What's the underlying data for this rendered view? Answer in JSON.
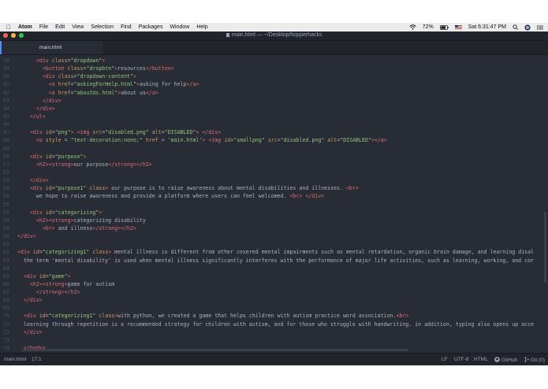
{
  "menubar": {
    "app_name": "Atom",
    "items": [
      "File",
      "Edit",
      "View",
      "Selection",
      "Find",
      "Packages",
      "Window",
      "Help"
    ],
    "battery": "72%",
    "clock": "Sat 6:31:47 PM"
  },
  "window": {
    "title": "main.html — ~/Desktop/hopperhacks"
  },
  "tabs": [
    {
      "label": "main.html"
    }
  ],
  "editor": {
    "lines": [
      {
        "n": "38",
        "indent": 6,
        "t": [
          [
            "tg",
            "<div "
          ],
          [
            "at",
            "class"
          ],
          [
            "tx",
            "="
          ],
          [
            "st",
            "\"dropdown\""
          ],
          [
            "tg",
            ">"
          ]
        ]
      },
      {
        "n": "39",
        "indent": 8,
        "t": [
          [
            "tg",
            "<button "
          ],
          [
            "at",
            "class"
          ],
          [
            "tx",
            "="
          ],
          [
            "st",
            "\"dropbtn\""
          ],
          [
            "tg",
            ">"
          ],
          [
            "tx",
            "resources"
          ],
          [
            "tg",
            "</button>"
          ]
        ]
      },
      {
        "n": "40",
        "indent": 8,
        "t": [
          [
            "tg",
            "<div "
          ],
          [
            "at",
            "class"
          ],
          [
            "tx",
            "="
          ],
          [
            "st",
            "\"dropdown-content\""
          ],
          [
            "tg",
            ">"
          ]
        ]
      },
      {
        "n": "41",
        "indent": 10,
        "t": [
          [
            "tg",
            "<a "
          ],
          [
            "at",
            "href"
          ],
          [
            "tx",
            "="
          ],
          [
            "st",
            "\"askingForHelp.html\""
          ],
          [
            "tg",
            ">"
          ],
          [
            "tx",
            "asking for help"
          ],
          [
            "tg",
            "</a>"
          ]
        ]
      },
      {
        "n": "42",
        "indent": 10,
        "t": [
          [
            "tg",
            "<a "
          ],
          [
            "at",
            "href"
          ],
          [
            "tx",
            "="
          ],
          [
            "st",
            "\"aboutUs.html\""
          ],
          [
            "tg",
            ">"
          ],
          [
            "tx",
            "about us"
          ],
          [
            "tg",
            "</a>"
          ]
        ]
      },
      {
        "n": "43",
        "indent": 8,
        "t": [
          [
            "tg",
            "</div>"
          ]
        ]
      },
      {
        "n": "44",
        "indent": 6,
        "t": [
          [
            "tg",
            "</div>"
          ]
        ]
      },
      {
        "n": "45",
        "indent": 4,
        "t": [
          [
            "tg",
            "</ul>"
          ]
        ]
      },
      {
        "n": "46",
        "indent": 0,
        "t": []
      },
      {
        "n": "47",
        "indent": 4,
        "t": [
          [
            "tg",
            "<div "
          ],
          [
            "at",
            "id"
          ],
          [
            "tx",
            "="
          ],
          [
            "st",
            "\"png\""
          ],
          [
            "tg",
            ">"
          ],
          [
            "tx",
            " "
          ],
          [
            "tg",
            "<img "
          ],
          [
            "at",
            "src"
          ],
          [
            "tx",
            "="
          ],
          [
            "st",
            "\"disabled.png\""
          ],
          [
            "tx",
            " "
          ],
          [
            "at",
            "alt"
          ],
          [
            "tx",
            "="
          ],
          [
            "st",
            "\"DISABLED\""
          ],
          [
            "tg",
            ">"
          ],
          [
            "tx",
            " "
          ],
          [
            "tg",
            "</div>"
          ]
        ]
      },
      {
        "n": "48",
        "indent": 6,
        "t": [
          [
            "tg",
            "<a "
          ],
          [
            "at",
            "style"
          ],
          [
            "tx",
            " = "
          ],
          [
            "st",
            "\"text-decoration:none;\""
          ],
          [
            "tx",
            " "
          ],
          [
            "at",
            "href"
          ],
          [
            "tx",
            " = "
          ],
          [
            "st",
            "'main.html'"
          ],
          [
            "tg",
            ">"
          ],
          [
            "tx",
            " "
          ],
          [
            "tg",
            "<img "
          ],
          [
            "at",
            "id"
          ],
          [
            "tx",
            "="
          ],
          [
            "st",
            "\"smallpng\""
          ],
          [
            "tx",
            " "
          ],
          [
            "at",
            "src"
          ],
          [
            "tx",
            "="
          ],
          [
            "st",
            "\"disabled.png\""
          ],
          [
            "tx",
            " "
          ],
          [
            "at",
            "alt"
          ],
          [
            "tx",
            "="
          ],
          [
            "st",
            "\"DISABLED\""
          ],
          [
            "tg",
            "></a>"
          ]
        ]
      },
      {
        "n": "49",
        "indent": 0,
        "t": []
      },
      {
        "n": "50",
        "indent": 4,
        "t": [
          [
            "tg",
            "<div "
          ],
          [
            "at",
            "id"
          ],
          [
            "tx",
            "="
          ],
          [
            "st",
            "\"purpose\""
          ],
          [
            "tg",
            ">"
          ]
        ]
      },
      {
        "n": "51",
        "indent": 6,
        "t": [
          [
            "tg",
            "<h2><strong>"
          ],
          [
            "tx",
            "our purpose"
          ],
          [
            "tg",
            "</strong></h2>"
          ]
        ]
      },
      {
        "n": "52",
        "indent": 0,
        "t": []
      },
      {
        "n": "53",
        "indent": 4,
        "t": [
          [
            "tg",
            "</div>"
          ]
        ]
      },
      {
        "n": "54",
        "indent": 4,
        "t": [
          [
            "tg",
            "<div "
          ],
          [
            "at",
            "id"
          ],
          [
            "tx",
            "="
          ],
          [
            "st",
            "\"purpose1\""
          ],
          [
            "tx",
            " "
          ],
          [
            "at",
            "class"
          ],
          [
            "tg",
            ">"
          ],
          [
            "tx",
            " our purpose is to raise awareness about mental disabilities and illnesses. "
          ],
          [
            "tg",
            "<br>"
          ]
        ]
      },
      {
        "n": "55",
        "indent": 6,
        "t": [
          [
            "tx",
            "we hope to raise awareness and provide a platform where users can feel welcomed. "
          ],
          [
            "tg",
            "<br>"
          ],
          [
            "tx",
            " "
          ],
          [
            "tg",
            "</div>"
          ]
        ]
      },
      {
        "n": "56",
        "indent": 0,
        "t": []
      },
      {
        "n": "57",
        "indent": 4,
        "t": [
          [
            "tg",
            "<div "
          ],
          [
            "at",
            "id"
          ],
          [
            "tx",
            "="
          ],
          [
            "st",
            "\"categorizing\""
          ],
          [
            "tg",
            ">"
          ]
        ]
      },
      {
        "n": "58",
        "indent": 6,
        "t": [
          [
            "tg",
            "<h2><strong>"
          ],
          [
            "tx",
            "categorizing disability"
          ]
        ]
      },
      {
        "n": "59",
        "indent": 8,
        "t": [
          [
            "tg",
            "<br>"
          ],
          [
            "tx",
            " and illness"
          ],
          [
            "tg",
            "</strong></h2>"
          ]
        ]
      },
      {
        "n": "60",
        "indent": 0,
        "t": [
          [
            "tg",
            "</div>"
          ]
        ]
      },
      {
        "n": "61",
        "indent": 0,
        "t": []
      },
      {
        "n": "62",
        "indent": 0,
        "t": [
          [
            "tg",
            "<div "
          ],
          [
            "at",
            "id"
          ],
          [
            "tx",
            "="
          ],
          [
            "st",
            "\"categorizing1\""
          ],
          [
            "tx",
            " "
          ],
          [
            "at",
            "class"
          ],
          [
            "tg",
            ">"
          ],
          [
            "tx",
            " mental illness is different from other covered mental impairments such as mental retardation, organic brain damage, and learning disal"
          ]
        ]
      },
      {
        "n": "63",
        "indent": 2,
        "t": [
          [
            "tx",
            "the term 'mental disability' is used when mental illness significantly interferes with the performance of major life activities, such as learning, working, and cor"
          ]
        ]
      },
      {
        "n": "64",
        "indent": 0,
        "t": []
      },
      {
        "n": "65",
        "indent": 2,
        "t": [
          [
            "tg",
            "<div "
          ],
          [
            "at",
            "id"
          ],
          [
            "tx",
            "="
          ],
          [
            "st",
            "\"game\""
          ],
          [
            "tg",
            ">"
          ]
        ]
      },
      {
        "n": "66",
        "indent": 4,
        "t": [
          [
            "tg",
            "<h2><strong>"
          ],
          [
            "tx",
            "game for autism"
          ]
        ]
      },
      {
        "n": "67",
        "indent": 6,
        "t": [
          [
            "tg",
            "</strong></h2>"
          ]
        ]
      },
      {
        "n": "68",
        "indent": 2,
        "t": [
          [
            "tg",
            "</div>"
          ]
        ]
      },
      {
        "n": "69",
        "indent": 0,
        "t": []
      },
      {
        "n": "70",
        "indent": 2,
        "t": [
          [
            "tg",
            "<div "
          ],
          [
            "at",
            "id"
          ],
          [
            "tx",
            "="
          ],
          [
            "st",
            "\"categorizing1\""
          ],
          [
            "tx",
            " "
          ],
          [
            "at",
            "class"
          ],
          [
            "tg",
            ">"
          ],
          [
            "tx",
            "with python, we created a game that helps children with autism practice word association."
          ],
          [
            "tg",
            "<br>"
          ]
        ]
      },
      {
        "n": "71",
        "indent": 2,
        "t": [
          [
            "tx",
            "learning through repetition is a recommended strategy for children with autism, and for those who struggle with handwriting. in addition, typing also opens up acce"
          ]
        ]
      },
      {
        "n": "72",
        "indent": 2,
        "t": [
          [
            "tg",
            "</div>"
          ]
        ]
      },
      {
        "n": "73",
        "indent": 0,
        "t": []
      },
      {
        "n": "74",
        "indent": 2,
        "t": [
          [
            "tg",
            "</body>"
          ]
        ]
      }
    ]
  },
  "status": {
    "file": "main.html",
    "cursor": "17:1",
    "line_ending": "LF",
    "encoding": "UTF-8",
    "grammar": "HTML",
    "github": "GitHub",
    "git": "Git (0)"
  },
  "colors": {
    "background": "#282c34",
    "tag": "#e06c75",
    "attribute": "#d19a66",
    "string": "#98c379",
    "text": "#abb2bf",
    "accent": "#568af2"
  }
}
